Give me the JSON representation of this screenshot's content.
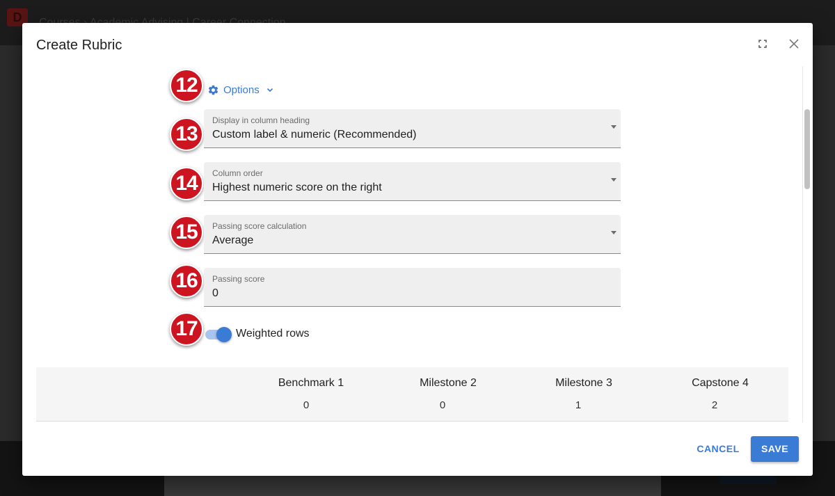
{
  "background": {
    "breadcrumb": "Courses › Academic Advising | Career Connection"
  },
  "dialog": {
    "title": "Create Rubric"
  },
  "badges": [
    "12",
    "13",
    "14",
    "15",
    "16",
    "17"
  ],
  "options": {
    "label": "Options"
  },
  "fields": {
    "display": {
      "label": "Display in column heading",
      "value": "Custom label & numeric (Recommended)"
    },
    "order": {
      "label": "Column order",
      "value": "Highest numeric score on the right"
    },
    "calc": {
      "label": "Passing score calculation",
      "value": "Average"
    },
    "passing": {
      "label": "Passing score",
      "value": "0"
    }
  },
  "weighted": {
    "label": "Weighted rows",
    "on": true
  },
  "rubric": {
    "columns": [
      {
        "name": "Benchmark 1",
        "score": "0"
      },
      {
        "name": "Milestone 2",
        "score": "0"
      },
      {
        "name": "Milestone 3",
        "score": "1"
      },
      {
        "name": "Capstone 4",
        "score": "2"
      }
    ]
  },
  "footer": {
    "cancel": "CANCEL",
    "save": "SAVE"
  },
  "colors": {
    "accent": "#3a7bd5",
    "badge": "#cc1520"
  },
  "icons": [
    "gear-icon",
    "chevron-down-icon",
    "fullscreen-icon",
    "close-icon",
    "dropdown-caret-icon"
  ]
}
